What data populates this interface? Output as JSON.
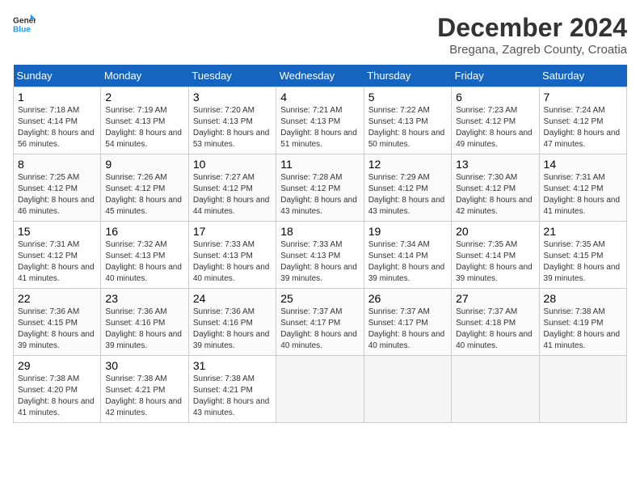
{
  "logo": {
    "text_general": "General",
    "text_blue": "Blue"
  },
  "header": {
    "month": "December 2024",
    "location": "Bregana, Zagreb County, Croatia"
  },
  "weekdays": [
    "Sunday",
    "Monday",
    "Tuesday",
    "Wednesday",
    "Thursday",
    "Friday",
    "Saturday"
  ],
  "weeks": [
    [
      {
        "day": 1,
        "sunrise": "7:18 AM",
        "sunset": "4:14 PM",
        "daylight": "8 hours and 56 minutes."
      },
      {
        "day": 2,
        "sunrise": "7:19 AM",
        "sunset": "4:13 PM",
        "daylight": "8 hours and 54 minutes."
      },
      {
        "day": 3,
        "sunrise": "7:20 AM",
        "sunset": "4:13 PM",
        "daylight": "8 hours and 53 minutes."
      },
      {
        "day": 4,
        "sunrise": "7:21 AM",
        "sunset": "4:13 PM",
        "daylight": "8 hours and 51 minutes."
      },
      {
        "day": 5,
        "sunrise": "7:22 AM",
        "sunset": "4:13 PM",
        "daylight": "8 hours and 50 minutes."
      },
      {
        "day": 6,
        "sunrise": "7:23 AM",
        "sunset": "4:12 PM",
        "daylight": "8 hours and 49 minutes."
      },
      {
        "day": 7,
        "sunrise": "7:24 AM",
        "sunset": "4:12 PM",
        "daylight": "8 hours and 47 minutes."
      }
    ],
    [
      {
        "day": 8,
        "sunrise": "7:25 AM",
        "sunset": "4:12 PM",
        "daylight": "8 hours and 46 minutes."
      },
      {
        "day": 9,
        "sunrise": "7:26 AM",
        "sunset": "4:12 PM",
        "daylight": "8 hours and 45 minutes."
      },
      {
        "day": 10,
        "sunrise": "7:27 AM",
        "sunset": "4:12 PM",
        "daylight": "8 hours and 44 minutes."
      },
      {
        "day": 11,
        "sunrise": "7:28 AM",
        "sunset": "4:12 PM",
        "daylight": "8 hours and 43 minutes."
      },
      {
        "day": 12,
        "sunrise": "7:29 AM",
        "sunset": "4:12 PM",
        "daylight": "8 hours and 43 minutes."
      },
      {
        "day": 13,
        "sunrise": "7:30 AM",
        "sunset": "4:12 PM",
        "daylight": "8 hours and 42 minutes."
      },
      {
        "day": 14,
        "sunrise": "7:31 AM",
        "sunset": "4:12 PM",
        "daylight": "8 hours and 41 minutes."
      }
    ],
    [
      {
        "day": 15,
        "sunrise": "7:31 AM",
        "sunset": "4:12 PM",
        "daylight": "8 hours and 41 minutes."
      },
      {
        "day": 16,
        "sunrise": "7:32 AM",
        "sunset": "4:13 PM",
        "daylight": "8 hours and 40 minutes."
      },
      {
        "day": 17,
        "sunrise": "7:33 AM",
        "sunset": "4:13 PM",
        "daylight": "8 hours and 40 minutes."
      },
      {
        "day": 18,
        "sunrise": "7:33 AM",
        "sunset": "4:13 PM",
        "daylight": "8 hours and 39 minutes."
      },
      {
        "day": 19,
        "sunrise": "7:34 AM",
        "sunset": "4:14 PM",
        "daylight": "8 hours and 39 minutes."
      },
      {
        "day": 20,
        "sunrise": "7:35 AM",
        "sunset": "4:14 PM",
        "daylight": "8 hours and 39 minutes."
      },
      {
        "day": 21,
        "sunrise": "7:35 AM",
        "sunset": "4:15 PM",
        "daylight": "8 hours and 39 minutes."
      }
    ],
    [
      {
        "day": 22,
        "sunrise": "7:36 AM",
        "sunset": "4:15 PM",
        "daylight": "8 hours and 39 minutes."
      },
      {
        "day": 23,
        "sunrise": "7:36 AM",
        "sunset": "4:16 PM",
        "daylight": "8 hours and 39 minutes."
      },
      {
        "day": 24,
        "sunrise": "7:36 AM",
        "sunset": "4:16 PM",
        "daylight": "8 hours and 39 minutes."
      },
      {
        "day": 25,
        "sunrise": "7:37 AM",
        "sunset": "4:17 PM",
        "daylight": "8 hours and 40 minutes."
      },
      {
        "day": 26,
        "sunrise": "7:37 AM",
        "sunset": "4:17 PM",
        "daylight": "8 hours and 40 minutes."
      },
      {
        "day": 27,
        "sunrise": "7:37 AM",
        "sunset": "4:18 PM",
        "daylight": "8 hours and 40 minutes."
      },
      {
        "day": 28,
        "sunrise": "7:38 AM",
        "sunset": "4:19 PM",
        "daylight": "8 hours and 41 minutes."
      }
    ],
    [
      {
        "day": 29,
        "sunrise": "7:38 AM",
        "sunset": "4:20 PM",
        "daylight": "8 hours and 41 minutes."
      },
      {
        "day": 30,
        "sunrise": "7:38 AM",
        "sunset": "4:21 PM",
        "daylight": "8 hours and 42 minutes."
      },
      {
        "day": 31,
        "sunrise": "7:38 AM",
        "sunset": "4:21 PM",
        "daylight": "8 hours and 43 minutes."
      },
      null,
      null,
      null,
      null
    ]
  ],
  "labels": {
    "sunrise": "Sunrise:",
    "sunset": "Sunset:",
    "daylight": "Daylight:"
  }
}
